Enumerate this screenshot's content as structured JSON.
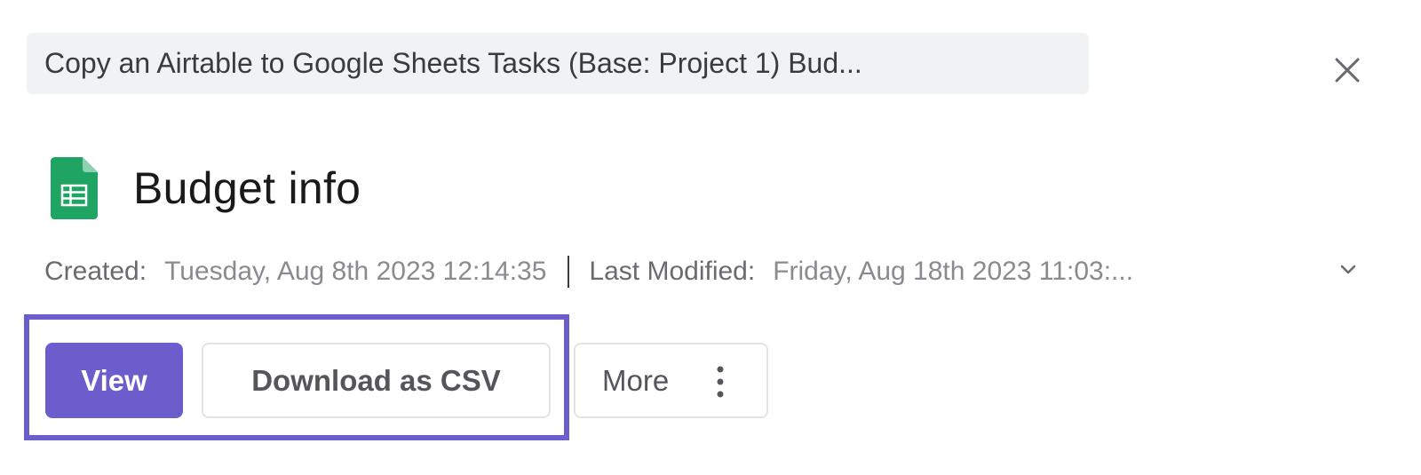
{
  "breadcrumb": {
    "text": "Copy an Airtable to Google Sheets Tasks (Base: Project 1) Bud..."
  },
  "file": {
    "title": "Budget info",
    "icon": "google-sheets-icon"
  },
  "meta": {
    "created_label": "Created:",
    "created_value": "Tuesday, Aug 8th 2023 12:14:35",
    "modified_label": "Last Modified:",
    "modified_value": "Friday, Aug 18th 2023 11:03:..."
  },
  "actions": {
    "view_label": "View",
    "download_label": "Download as CSV",
    "more_label": "More"
  },
  "colors": {
    "accent": "#6c5dcc",
    "sheets_green": "#1fa463",
    "highlight_border": "#6c5dcc"
  },
  "icons": {
    "close": "close-icon",
    "expand": "chevron-down-icon",
    "more": "vertical-ellipsis-icon"
  }
}
